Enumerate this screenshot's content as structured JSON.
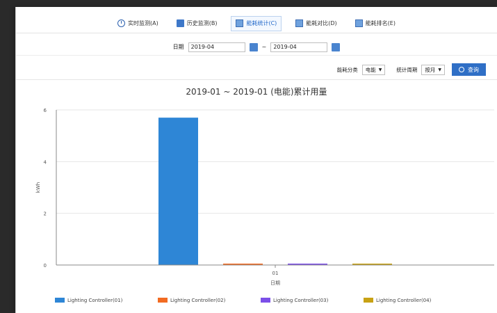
{
  "tabs": [
    {
      "label": "实时监测(A)",
      "icon": "clock-icon"
    },
    {
      "label": "历史监测(B)",
      "icon": "calendar-icon"
    },
    {
      "label": "能耗统计(C)",
      "icon": "document-icon"
    },
    {
      "label": "能耗对比(D)",
      "icon": "document-icon"
    },
    {
      "label": "能耗排名(E)",
      "icon": "document-icon"
    }
  ],
  "active_tab": 2,
  "date_range": {
    "label": "日期",
    "from": "2019-04",
    "separator": "~",
    "to": "2019-04"
  },
  "filters": {
    "type_label": "能耗分类",
    "type_value": "电能",
    "period_label": "统计周期",
    "period_value": "按月",
    "search_label": "查询"
  },
  "colors": {
    "accent": "#2f6fc6",
    "series": [
      "#2e86d6",
      "#f26b22",
      "#7b4fe8",
      "#c8a214"
    ]
  },
  "chart_data": {
    "type": "bar",
    "title": "2019-01 ~ 2019-01 (电能)累计用量",
    "categories": [
      "01"
    ],
    "xlabel": "日期",
    "ylabel": "kWh",
    "ylim": [
      0,
      6
    ],
    "yticks": [
      0,
      2,
      4,
      6
    ],
    "series": [
      {
        "name": "Lighting Controller(01)",
        "values": [
          5.7
        ]
      },
      {
        "name": "Lighting Controller(02)",
        "values": [
          0.05
        ]
      },
      {
        "name": "Lighting Controller(03)",
        "values": [
          0.05
        ]
      },
      {
        "name": "Lighting Controller(04)",
        "values": [
          0.05
        ]
      }
    ],
    "grid": true,
    "legend": "bottom"
  }
}
